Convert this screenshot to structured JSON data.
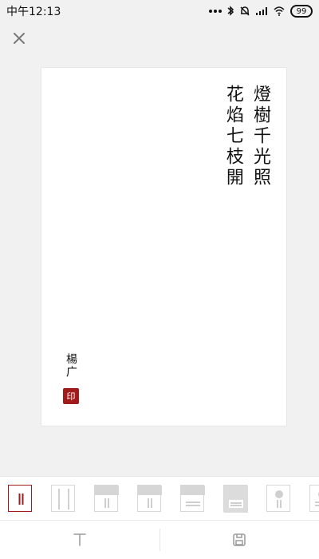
{
  "status_bar": {
    "time": "中午12:13",
    "battery": "99",
    "icons": [
      "dots-icon",
      "bluetooth-icon",
      "mute-icon",
      "signal-icon",
      "wifi-icon",
      "battery-icon"
    ]
  },
  "header": {
    "close_icon": "close-icon"
  },
  "card": {
    "poem": {
      "lines": [
        "燈樹千光照",
        "花焰七枝開"
      ]
    },
    "signature": "楊广",
    "seal": "印"
  },
  "template_strip": {
    "selected_index": 0,
    "count": 8
  },
  "toolbar": {
    "text_tool_icon": "text-icon",
    "save_icon": "save-icon"
  }
}
